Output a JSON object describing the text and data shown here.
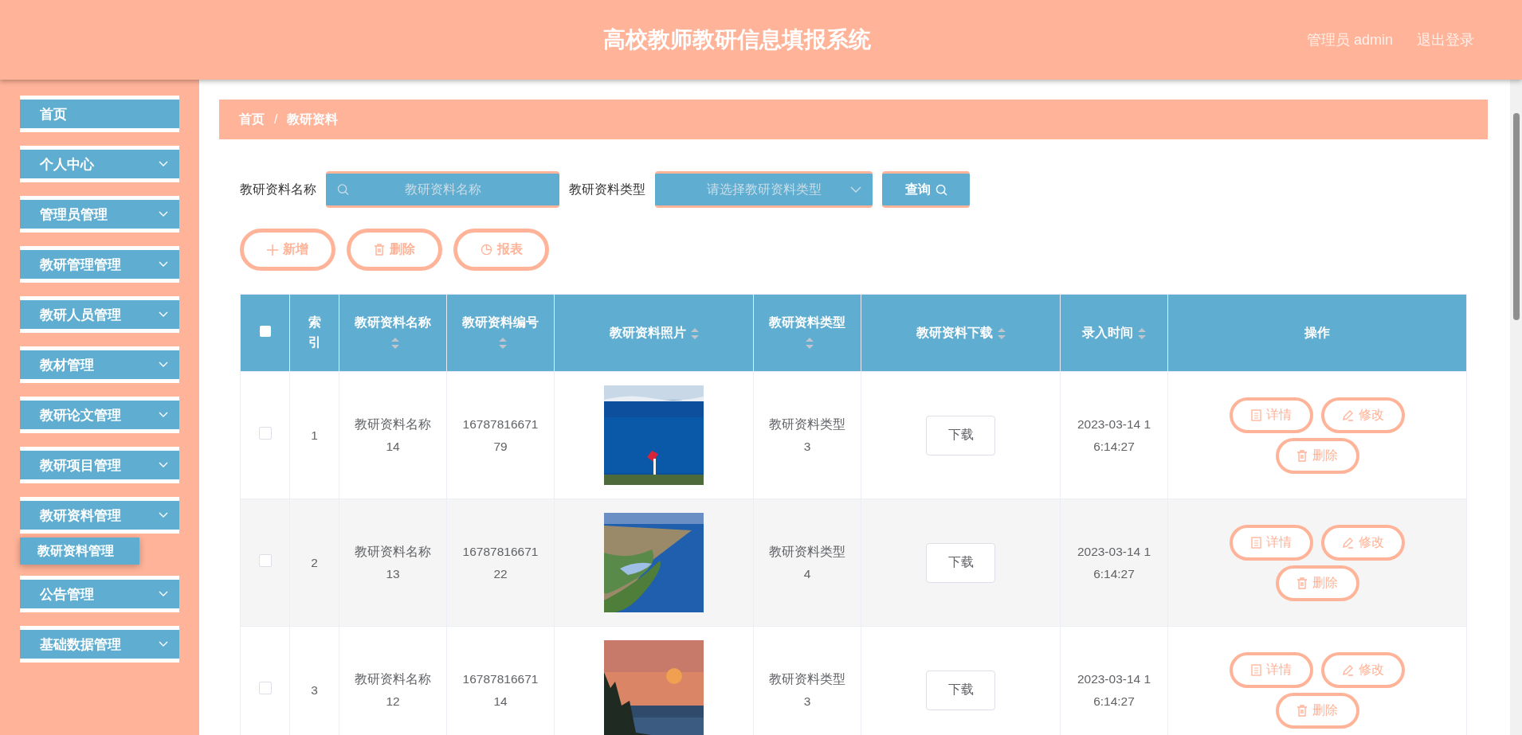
{
  "header": {
    "title": "高校教师教研信息填报系统",
    "user": "管理员 admin",
    "logout": "退出登录"
  },
  "sidebar": {
    "items": [
      {
        "label": "首页",
        "kind": "link"
      },
      {
        "label": "个人中心",
        "kind": "menu"
      },
      {
        "label": "管理员管理",
        "kind": "menu"
      },
      {
        "label": "教研管理管理",
        "kind": "menu"
      },
      {
        "label": "教研人员管理",
        "kind": "menu"
      },
      {
        "label": "教材管理",
        "kind": "menu"
      },
      {
        "label": "教研论文管理",
        "kind": "menu"
      },
      {
        "label": "教研项目管理",
        "kind": "menu"
      },
      {
        "label": "教研资料管理",
        "kind": "menu",
        "children": [
          {
            "label": "教研资料管理"
          }
        ]
      },
      {
        "label": "公告管理",
        "kind": "menu"
      },
      {
        "label": "基础数据管理",
        "kind": "menu"
      }
    ]
  },
  "breadcrumb": {
    "items": [
      "首页",
      "教研资料"
    ],
    "separator": "/"
  },
  "search": {
    "fields": [
      {
        "label": "教研资料名称",
        "kind": "text",
        "placeholder": "教研资料名称"
      },
      {
        "label": "教研资料类型",
        "kind": "select",
        "placeholder": "请选择教研资料类型"
      }
    ],
    "button": "查询"
  },
  "actions": [
    {
      "label": "新增",
      "kind": "add"
    },
    {
      "label": "删除",
      "kind": "delete"
    },
    {
      "label": "报表",
      "kind": "report"
    }
  ],
  "table": {
    "select_all": {
      "checked": false
    },
    "columns": [
      {
        "label": "索引",
        "sortable": false
      },
      {
        "label": "教研资料名称",
        "sortable": true
      },
      {
        "label": "教研资料编号",
        "sortable": true
      },
      {
        "label": "教研资料照片",
        "sortable": true
      },
      {
        "label": "教研资料类型",
        "sortable": true
      },
      {
        "label": "教研资料下载",
        "sortable": true
      },
      {
        "label": "录入时间",
        "sortable": true
      },
      {
        "label": "操作",
        "sortable": false
      }
    ],
    "rows": [
      {
        "checked": false,
        "index": "1",
        "name": "教研资料名称14",
        "number": "1678781667179",
        "type": "教研资料类型3",
        "download": "下载",
        "time": "2023-03-14 16:14:27",
        "actions": [
          "详情",
          "修改",
          "删除"
        ]
      },
      {
        "checked": false,
        "index": "2",
        "name": "教研资料名称13",
        "number": "1678781667122",
        "type": "教研资料类型4",
        "download": "下载",
        "time": "2023-03-14 16:14:27",
        "actions": [
          "详情",
          "修改",
          "删除"
        ]
      },
      {
        "checked": false,
        "index": "3",
        "name": "教研资料名称12",
        "number": "1678781667114",
        "type": "教研资料类型3",
        "download": "下载",
        "time": "2023-03-14 16:14:27",
        "actions": [
          "详情",
          "修改",
          "删除"
        ]
      }
    ]
  }
}
